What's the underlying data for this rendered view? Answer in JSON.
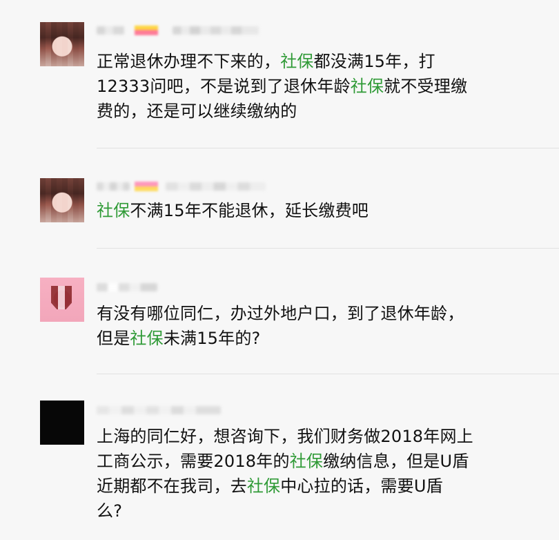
{
  "thread": {
    "messages": [
      {
        "segments": [
          {
            "text": "正常退休办理不下来的，",
            "accent": false
          },
          {
            "text": "社保",
            "accent": true
          },
          {
            "text": "都没满15年，打",
            "accent": false
          }
        ],
        "segments_line2": [
          {
            "text": "12333问吧，不是说到了退休年龄",
            "accent": false
          },
          {
            "text": "社保",
            "accent": true
          },
          {
            "text": "就不受理缴",
            "accent": false
          }
        ],
        "segments_line3": [
          {
            "text": "费的，还是可以继续缴纳的",
            "accent": false
          }
        ]
      },
      {
        "segments": [
          {
            "text": "社保",
            "accent": true
          },
          {
            "text": "不满15年不能退休，延长缴费吧",
            "accent": false
          }
        ]
      },
      {
        "segments": [
          {
            "text": "有没有哪位同仁，办过外地户口，到了退休年龄，",
            "accent": false
          }
        ],
        "segments_line2": [
          {
            "text": "但是",
            "accent": false
          },
          {
            "text": "社保",
            "accent": true
          },
          {
            "text": "未满15年的?",
            "accent": false
          }
        ]
      },
      {
        "segments": [
          {
            "text": "上海的同仁好，想咨询下，我们财务做2018年网上",
            "accent": false
          }
        ],
        "segments_line2": [
          {
            "text": "工商公示，需要2018年的",
            "accent": false
          },
          {
            "text": "社保",
            "accent": true
          },
          {
            "text": "缴纳信息，但是U盾",
            "accent": false
          }
        ],
        "segments_line3": [
          {
            "text": "近期都不在我司，去",
            "accent": false
          },
          {
            "text": "社保",
            "accent": true
          },
          {
            "text": "中心拉的话，需要U盾",
            "accent": false
          }
        ],
        "segments_line4": [
          {
            "text": "么?",
            "accent": false
          }
        ]
      }
    ]
  },
  "colors": {
    "accent_text": "#2f9a36",
    "body_text": "#111111",
    "divider": "#e1e1e1"
  }
}
